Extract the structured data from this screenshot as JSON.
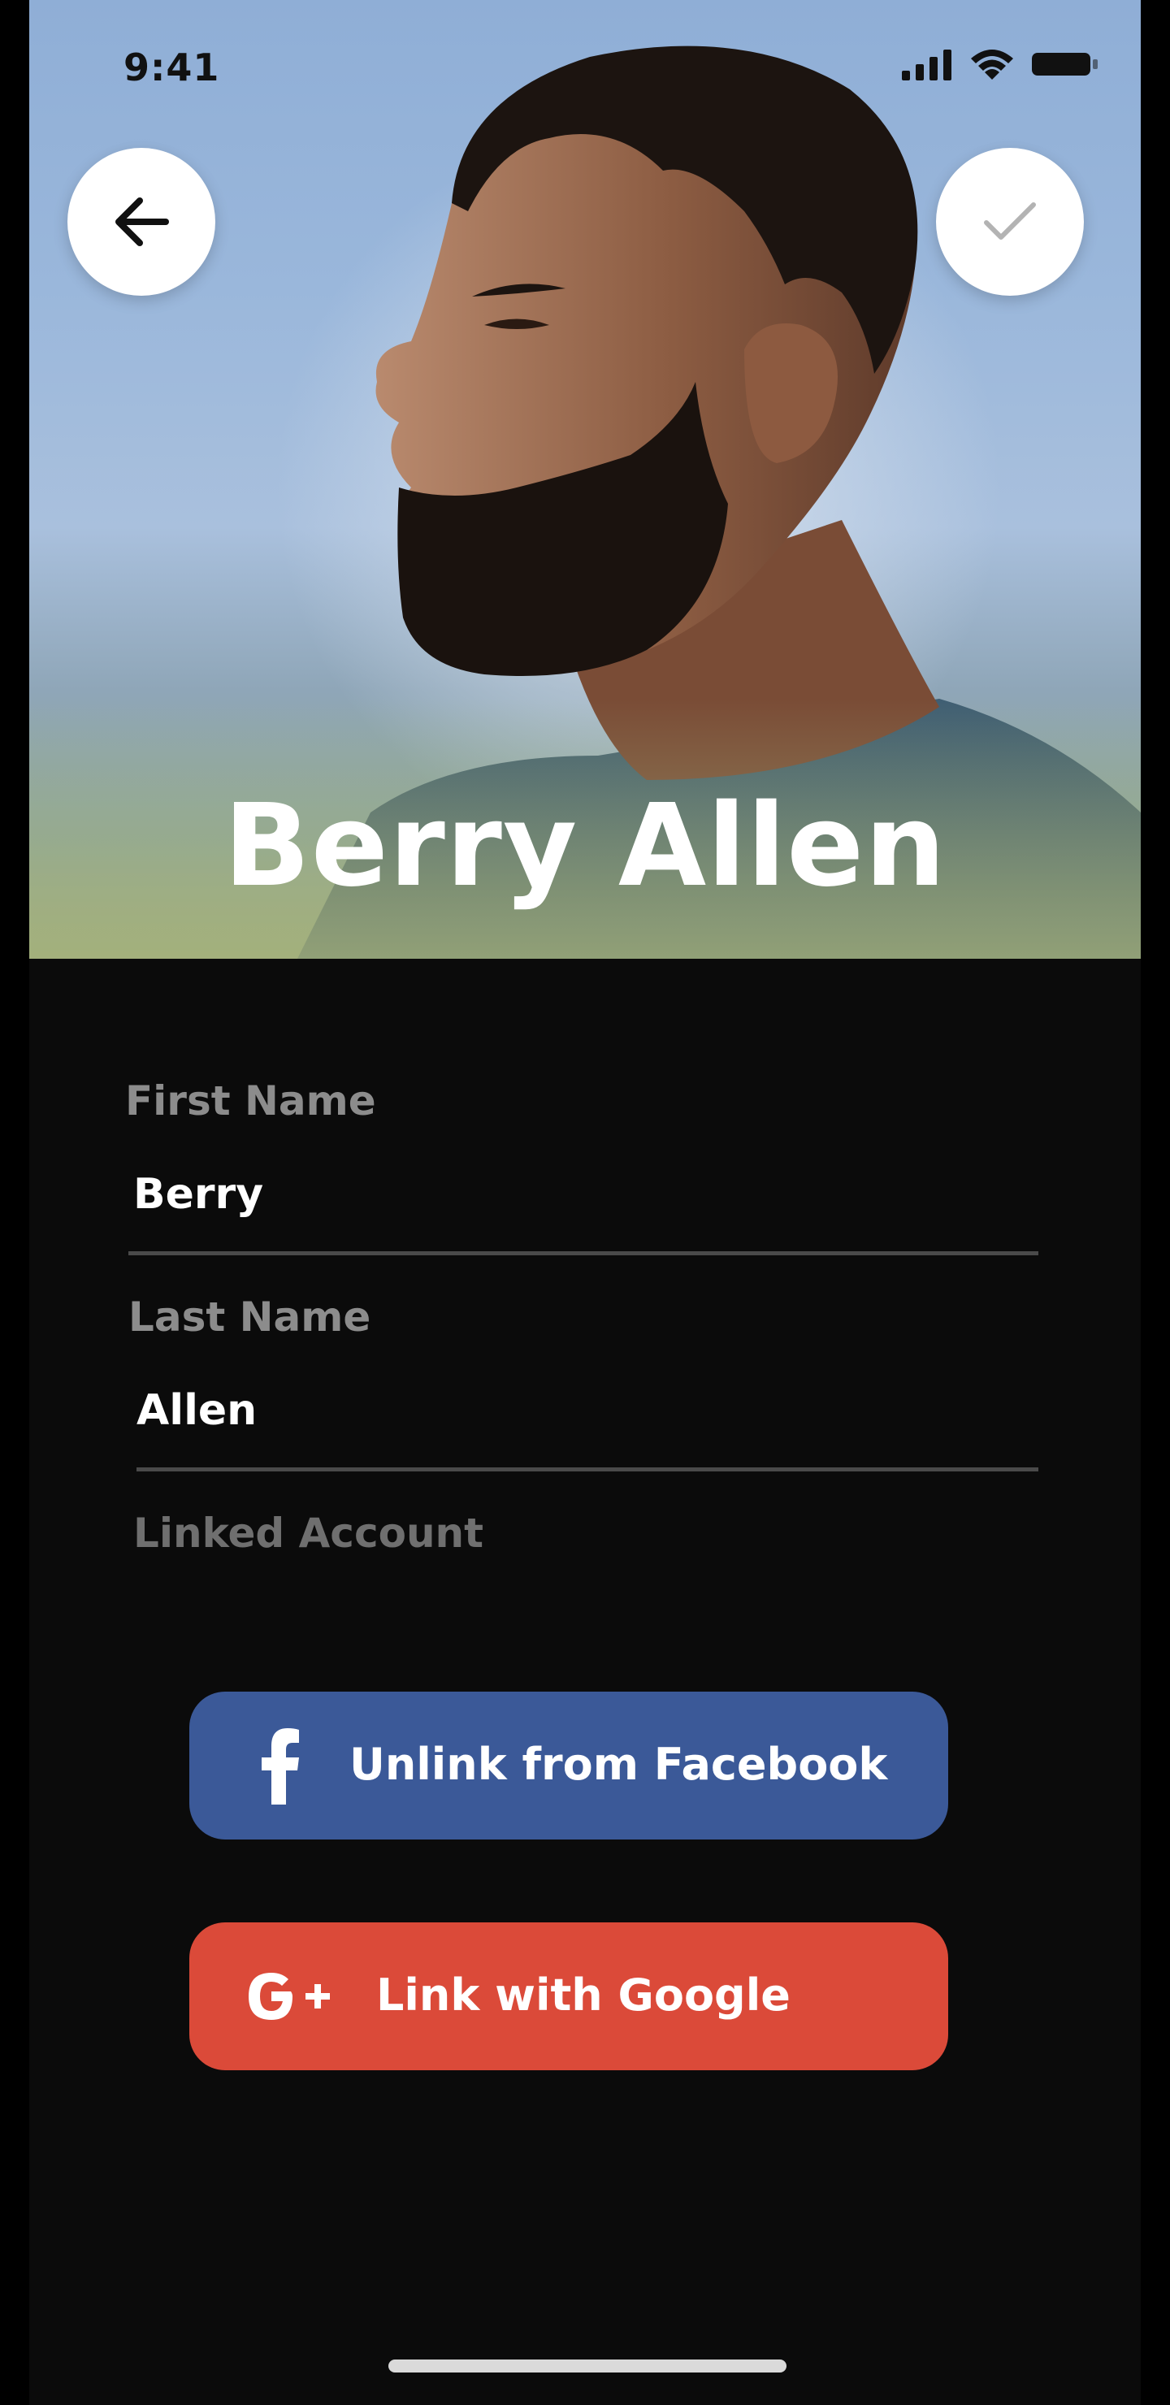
{
  "status_bar": {
    "time": "9:41"
  },
  "header": {
    "back_icon": "arrow-left-icon",
    "confirm_icon": "checkmark-icon",
    "profile_name": "Berry Allen"
  },
  "form": {
    "first_name": {
      "label": "First Name",
      "value": "Berry"
    },
    "last_name": {
      "label": "Last Name",
      "value": "Allen"
    },
    "linked_account": {
      "label": "Linked Account"
    }
  },
  "linked_accounts": {
    "facebook": {
      "label": "Unlink from Facebook",
      "icon": "facebook-icon",
      "color": "#3b5998"
    },
    "google": {
      "label": "Link with Google",
      "icon": "google-plus-icon",
      "color": "#db4a39"
    }
  },
  "colors": {
    "background": "#0b0b0b",
    "label": "#8c8c8c",
    "divider": "#4a4a4a"
  }
}
